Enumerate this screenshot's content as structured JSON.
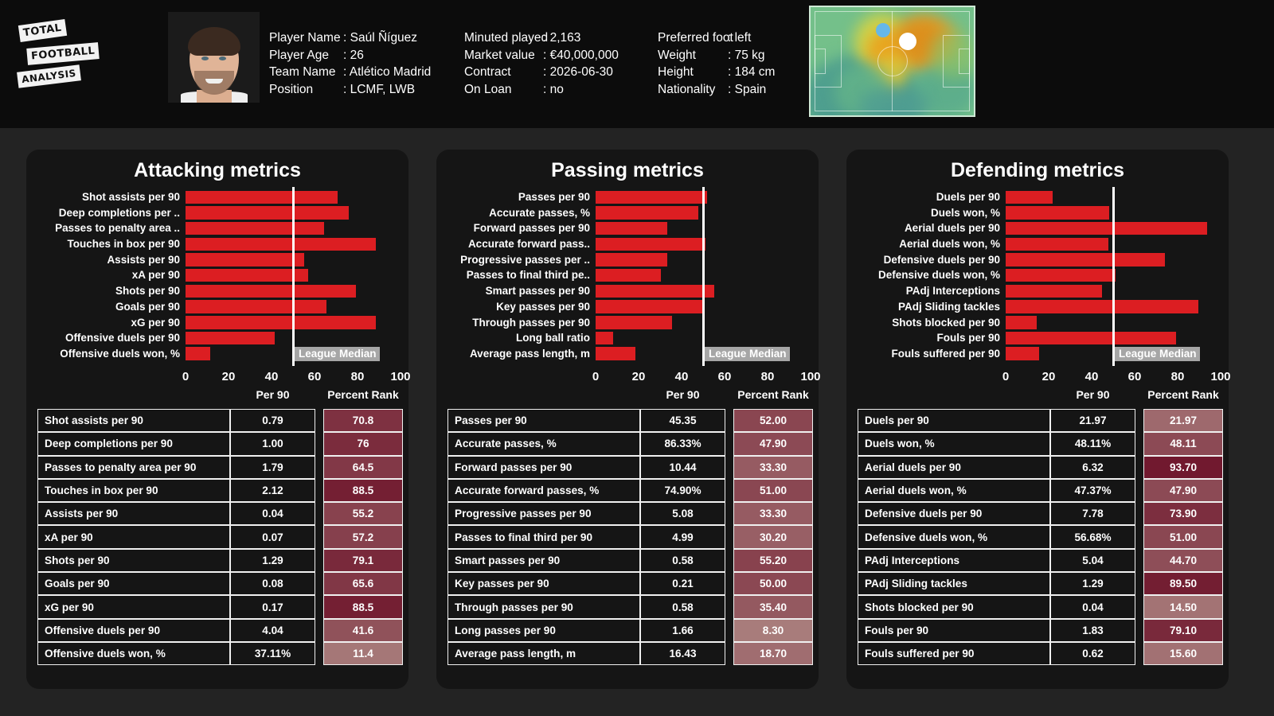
{
  "brand": {
    "line1": "TOTAL",
    "line2": "FOOTBALL",
    "line3": "ANALYSIS"
  },
  "header": {
    "photo_alt": "player-portrait",
    "info_left": [
      {
        "key": "Player Name",
        "value": ": Saúl Ñíguez"
      },
      {
        "key": "Player Age",
        "value": ": 26"
      },
      {
        "key": "Team Name",
        "value": ": Atlético Madrid"
      },
      {
        "key": "Position",
        "value": ": LCMF, LWB"
      }
    ],
    "info_mid": [
      {
        "key": "Minuted played",
        "value": ": 2,163"
      },
      {
        "key": "Market value",
        "value": ": €40,000,000"
      },
      {
        "key": "Contract",
        "value": ": 2026-06-30"
      },
      {
        "key": "On Loan",
        "value": ": no"
      }
    ],
    "info_right": [
      {
        "key": "Preferred foot",
        "value": ": left"
      },
      {
        "key": "Weight",
        "value": ": 75 kg"
      },
      {
        "key": "Height",
        "value": ": 184 cm"
      },
      {
        "key": "Nationality",
        "value": ": Spain"
      }
    ],
    "heatmap_name": "position-heatmap"
  },
  "table_headers": {
    "metric": "",
    "per90": "Per 90",
    "rank": "Percent Rank"
  },
  "median_label": "League Median",
  "axis_ticks": [
    "0",
    "20",
    "40",
    "60",
    "80",
    "100"
  ],
  "colors": {
    "bar": "#dc1e22",
    "median": "#ffffff",
    "median_tag_bg": "#a6a6a6",
    "panel_bg": "#151515",
    "page_bg": "#232323",
    "header_bg": "#0c0c0c",
    "rank_low": "#b08a86",
    "rank_high": "#6d132a"
  },
  "chart_data": [
    {
      "type": "bar",
      "title": "Attacking metrics",
      "xlabel": "",
      "ylabel": "",
      "xlim": [
        0,
        100
      ],
      "grid": false,
      "orientation": "horizontal",
      "annotation": "League Median",
      "median": 50,
      "categories": [
        "Shot assists per 90",
        "Deep completions per ..",
        "Passes to penalty area ..",
        "Touches in box per 90",
        "Assists per 90",
        "xA per 90",
        "Shots per 90",
        "Goals per 90",
        "xG per 90",
        "Offensive duels per 90",
        "Offensive duels won, %"
      ],
      "values": [
        70.8,
        76,
        64.5,
        88.5,
        55.2,
        57.2,
        79.1,
        65.6,
        88.5,
        41.6,
        11.4
      ],
      "table": {
        "columns": [
          "",
          "Per 90",
          "Percent Rank"
        ],
        "rows": [
          {
            "metric": "Shot assists per 90",
            "per90": "0.79",
            "rank": "70.8",
            "rank_value": 70.8
          },
          {
            "metric": "Deep completions per 90",
            "per90": "1.00",
            "rank": "76",
            "rank_value": 76
          },
          {
            "metric": "Passes to penalty area per 90",
            "per90": "1.79",
            "rank": "64.5",
            "rank_value": 64.5
          },
          {
            "metric": "Touches in box per 90",
            "per90": "2.12",
            "rank": "88.5",
            "rank_value": 88.5
          },
          {
            "metric": "Assists per 90",
            "per90": "0.04",
            "rank": "55.2",
            "rank_value": 55.2
          },
          {
            "metric": "xA per 90",
            "per90": "0.07",
            "rank": "57.2",
            "rank_value": 57.2
          },
          {
            "metric": "Shots per 90",
            "per90": "1.29",
            "rank": "79.1",
            "rank_value": 79.1
          },
          {
            "metric": "Goals per 90",
            "per90": "0.08",
            "rank": "65.6",
            "rank_value": 65.6
          },
          {
            "metric": "xG per 90",
            "per90": "0.17",
            "rank": "88.5",
            "rank_value": 88.5
          },
          {
            "metric": "Offensive duels per 90",
            "per90": "4.04",
            "rank": "41.6",
            "rank_value": 41.6
          },
          {
            "metric": "Offensive duels won, %",
            "per90": "37.11%",
            "rank": "11.4",
            "rank_value": 11.4
          }
        ]
      }
    },
    {
      "type": "bar",
      "title": "Passing metrics",
      "xlabel": "",
      "ylabel": "",
      "xlim": [
        0,
        100
      ],
      "grid": false,
      "orientation": "horizontal",
      "annotation": "League Median",
      "median": 50,
      "categories": [
        "Passes per 90",
        "Accurate passes, %",
        "Forward passes per 90",
        "Accurate forward pass..",
        "Progressive passes per ..",
        "Passes to final third pe..",
        "Smart passes per 90",
        "Key passes per 90",
        "Through passes per 90",
        "Long ball ratio",
        "Average pass length, m"
      ],
      "values": [
        52.0,
        47.9,
        33.3,
        51.0,
        33.3,
        30.2,
        55.2,
        50.0,
        35.4,
        8.3,
        18.7
      ],
      "table": {
        "columns": [
          "",
          "Per 90",
          "Percent Rank"
        ],
        "rows": [
          {
            "metric": "Passes per 90",
            "per90": "45.35",
            "rank": "52.00",
            "rank_value": 52.0
          },
          {
            "metric": "Accurate passes, %",
            "per90": "86.33%",
            "rank": "47.90",
            "rank_value": 47.9
          },
          {
            "metric": "Forward passes per 90",
            "per90": "10.44",
            "rank": "33.30",
            "rank_value": 33.3
          },
          {
            "metric": "Accurate forward passes, %",
            "per90": "74.90%",
            "rank": "51.00",
            "rank_value": 51.0
          },
          {
            "metric": "Progressive passes per 90",
            "per90": "5.08",
            "rank": "33.30",
            "rank_value": 33.3
          },
          {
            "metric": "Passes to final third per 90",
            "per90": "4.99",
            "rank": "30.20",
            "rank_value": 30.2
          },
          {
            "metric": "Smart passes per 90",
            "per90": "0.58",
            "rank": "55.20",
            "rank_value": 55.2
          },
          {
            "metric": "Key passes per 90",
            "per90": "0.21",
            "rank": "50.00",
            "rank_value": 50.0
          },
          {
            "metric": "Through passes per 90",
            "per90": "0.58",
            "rank": "35.40",
            "rank_value": 35.4
          },
          {
            "metric": "Long passes per 90",
            "per90": "1.66",
            "rank": "8.30",
            "rank_value": 8.3
          },
          {
            "metric": "Average pass length, m",
            "per90": "16.43",
            "rank": "18.70",
            "rank_value": 18.7
          }
        ]
      }
    },
    {
      "type": "bar",
      "title": "Defending metrics",
      "xlabel": "",
      "ylabel": "",
      "xlim": [
        0,
        100
      ],
      "grid": false,
      "orientation": "horizontal",
      "annotation": "League Median",
      "median": 50,
      "categories": [
        "Duels per 90",
        "Duels won, %",
        "Aerial duels per 90",
        "Aerial duels won, %",
        "Defensive duels per 90",
        "Defensive duels won, %",
        "PAdj Interceptions",
        "PAdj Sliding tackles",
        "Shots blocked per 90",
        "Fouls per 90",
        "Fouls suffered per 90"
      ],
      "values": [
        21.97,
        48.11,
        93.7,
        47.9,
        73.9,
        51.0,
        44.7,
        89.5,
        14.5,
        79.1,
        15.6
      ],
      "table": {
        "columns": [
          "",
          "Per 90",
          "Percent Rank"
        ],
        "rows": [
          {
            "metric": "Duels per 90",
            "per90": "21.97",
            "rank": "21.97",
            "rank_value": 21.97
          },
          {
            "metric": "Duels won, %",
            "per90": "48.11%",
            "rank": "48.11",
            "rank_value": 48.11
          },
          {
            "metric": "Aerial duels per 90",
            "per90": "6.32",
            "rank": "93.70",
            "rank_value": 93.7
          },
          {
            "metric": "Aerial duels won, %",
            "per90": "47.37%",
            "rank": "47.90",
            "rank_value": 47.9
          },
          {
            "metric": "Defensive duels per 90",
            "per90": "7.78",
            "rank": "73.90",
            "rank_value": 73.9
          },
          {
            "metric": "Defensive duels won, %",
            "per90": "56.68%",
            "rank": "51.00",
            "rank_value": 51.0
          },
          {
            "metric": "PAdj Interceptions",
            "per90": "5.04",
            "rank": "44.70",
            "rank_value": 44.7
          },
          {
            "metric": "PAdj Sliding tackles",
            "per90": "1.29",
            "rank": "89.50",
            "rank_value": 89.5
          },
          {
            "metric": "Shots blocked per 90",
            "per90": "0.04",
            "rank": "14.50",
            "rank_value": 14.5
          },
          {
            "metric": "Fouls per 90",
            "per90": "1.83",
            "rank": "79.10",
            "rank_value": 79.1
          },
          {
            "metric": "Fouls suffered per 90",
            "per90": "0.62",
            "rank": "15.60",
            "rank_value": 15.6
          }
        ]
      }
    }
  ]
}
